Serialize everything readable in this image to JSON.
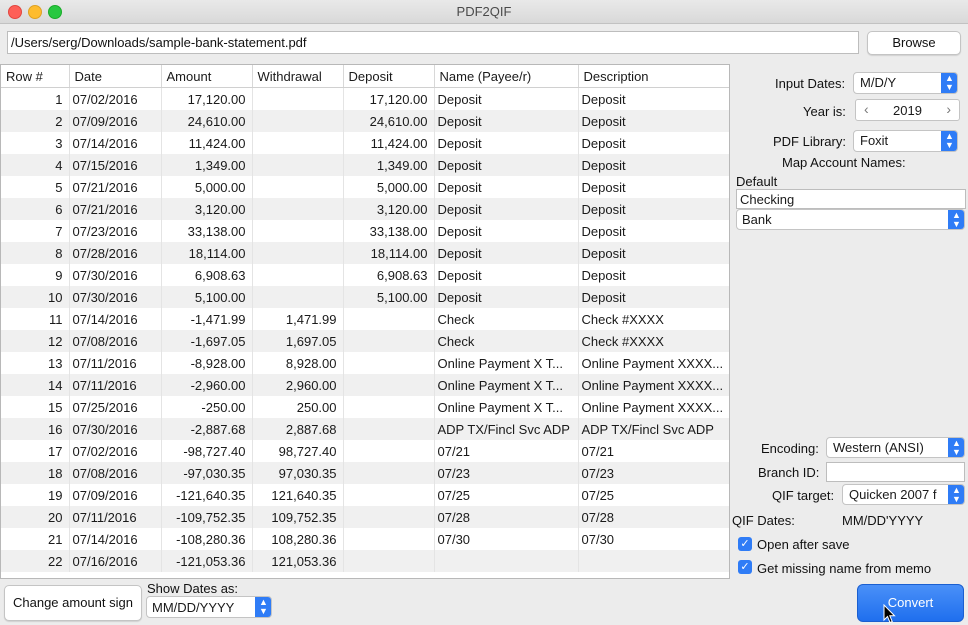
{
  "window": {
    "title": "PDF2QIF"
  },
  "file": {
    "path": "/Users/serg/Downloads/sample-bank-statement.pdf",
    "browse_label": "Browse"
  },
  "table": {
    "columns": [
      "Row #",
      "Date",
      "Amount",
      "Withdrawal",
      "Deposit",
      "Name (Payee/r)",
      "Description"
    ],
    "rows": [
      [
        "1",
        "07/02/2016",
        "17,120.00",
        "",
        "17,120.00",
        "Deposit",
        "Deposit"
      ],
      [
        "2",
        "07/09/2016",
        "24,610.00",
        "",
        "24,610.00",
        "Deposit",
        "Deposit"
      ],
      [
        "3",
        "07/14/2016",
        "11,424.00",
        "",
        "11,424.00",
        "Deposit",
        "Deposit"
      ],
      [
        "4",
        "07/15/2016",
        "1,349.00",
        "",
        "1,349.00",
        "Deposit",
        "Deposit"
      ],
      [
        "5",
        "07/21/2016",
        "5,000.00",
        "",
        "5,000.00",
        "Deposit",
        "Deposit"
      ],
      [
        "6",
        "07/21/2016",
        "3,120.00",
        "",
        "3,120.00",
        "Deposit",
        "Deposit"
      ],
      [
        "7",
        "07/23/2016",
        "33,138.00",
        "",
        "33,138.00",
        "Deposit",
        "Deposit"
      ],
      [
        "8",
        "07/28/2016",
        "18,114.00",
        "",
        "18,114.00",
        "Deposit",
        "Deposit"
      ],
      [
        "9",
        "07/30/2016",
        "6,908.63",
        "",
        "6,908.63",
        "Deposit",
        "Deposit"
      ],
      [
        "10",
        "07/30/2016",
        "5,100.00",
        "",
        "5,100.00",
        "Deposit",
        "Deposit"
      ],
      [
        "11",
        "07/14/2016",
        "-1,471.99",
        "1,471.99",
        "",
        "Check",
        "Check #XXXX"
      ],
      [
        "12",
        "07/08/2016",
        "-1,697.05",
        "1,697.05",
        "",
        "Check",
        "Check #XXXX"
      ],
      [
        "13",
        "07/11/2016",
        "-8,928.00",
        "8,928.00",
        "",
        "Online Payment X T...",
        "Online Payment XXXX..."
      ],
      [
        "14",
        "07/11/2016",
        "-2,960.00",
        "2,960.00",
        "",
        "Online Payment X T...",
        "Online Payment XXXX..."
      ],
      [
        "15",
        "07/25/2016",
        "-250.00",
        "250.00",
        "",
        "Online Payment X T...",
        "Online Payment XXXX..."
      ],
      [
        "16",
        "07/30/2016",
        "-2,887.68",
        "2,887.68",
        "",
        "ADP TX/Fincl Svc ADP",
        "ADP TX/Fincl Svc ADP"
      ],
      [
        "17",
        "07/02/2016",
        "-98,727.40",
        "98,727.40",
        "",
        "07/21",
        "07/21"
      ],
      [
        "18",
        "07/08/2016",
        "-97,030.35",
        "97,030.35",
        "",
        "07/23",
        "07/23"
      ],
      [
        "19",
        "07/09/2016",
        "-121,640.35",
        "121,640.35",
        "",
        "07/25",
        "07/25"
      ],
      [
        "20",
        "07/11/2016",
        "-109,752.35",
        "109,752.35",
        "",
        "07/28",
        "07/28"
      ],
      [
        "21",
        "07/14/2016",
        "-108,280.36",
        "108,280.36",
        "",
        "07/30",
        "07/30"
      ],
      [
        "22",
        "07/16/2016",
        "-121,053.36",
        "121,053.36",
        "",
        "",
        ""
      ]
    ]
  },
  "settings": {
    "input_dates_label": "Input Dates:",
    "input_dates_value": "M/D/Y",
    "year_label": "Year is:",
    "year_value": "2019",
    "pdf_library_label": "PDF Library:",
    "pdf_library_value": "Foxit",
    "map_accounts_label": "Map Account Names:",
    "default_label": "Default",
    "account_name": "Checking",
    "account_type": "Bank",
    "encoding_label": "Encoding:",
    "encoding_value": "Western (ANSI)",
    "branch_id_label": "Branch ID:",
    "branch_id_value": "",
    "qif_target_label": "QIF target:",
    "qif_target_value": "Quicken 2007 f",
    "qif_dates_label": "QIF Dates:",
    "qif_dates_value": "MM/DD'YYYY",
    "open_after_save": "Open after save",
    "get_missing_name": "Get missing name from memo"
  },
  "bottom": {
    "change_sign_label": "Change amount sign",
    "show_dates_label": "Show Dates as:",
    "show_dates_value": "MM/DD/YYYY",
    "convert_label": "Convert"
  }
}
